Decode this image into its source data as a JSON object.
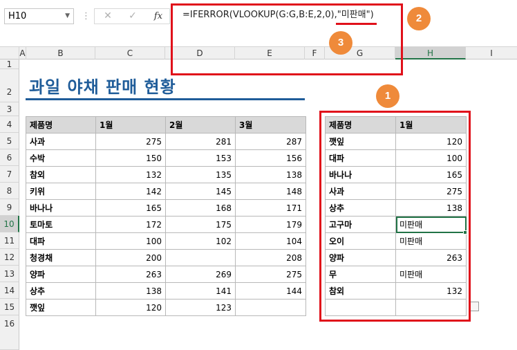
{
  "formula_bar": {
    "name_box": "H10",
    "cancel_symbol": "✕",
    "enter_symbol": "✓",
    "fx_label": "fx",
    "formula_text": "=IFERROR(VLOOKUP(G:G,B:E,2,0),\"미판매\")"
  },
  "columns": [
    "A",
    "B",
    "C",
    "D",
    "E",
    "F",
    "G",
    "H",
    "I"
  ],
  "rows": [
    "1",
    "2",
    "3",
    "4",
    "5",
    "6",
    "7",
    "8",
    "9",
    "10",
    "11",
    "12",
    "13",
    "14",
    "15",
    "16"
  ],
  "title": "과일 야채 판매 현황",
  "left_table": {
    "headers": [
      "제품명",
      "1월",
      "2월",
      "3월"
    ],
    "rows": [
      [
        "사과",
        "275",
        "281",
        "287"
      ],
      [
        "수박",
        "150",
        "153",
        "156"
      ],
      [
        "참외",
        "132",
        "135",
        "138"
      ],
      [
        "키위",
        "142",
        "145",
        "148"
      ],
      [
        "바나나",
        "165",
        "168",
        "171"
      ],
      [
        "토마토",
        "172",
        "175",
        "179"
      ],
      [
        "대파",
        "100",
        "102",
        "104"
      ],
      [
        "청경채",
        "200",
        "",
        "208"
      ],
      [
        "양파",
        "263",
        "269",
        "275"
      ],
      [
        "상추",
        "138",
        "141",
        "144"
      ],
      [
        "깻잎",
        "120",
        "123",
        ""
      ]
    ]
  },
  "right_table": {
    "headers": [
      "제품명",
      "1월"
    ],
    "rows": [
      [
        "깻잎",
        "120"
      ],
      [
        "대파",
        "100"
      ],
      [
        "바나나",
        "165"
      ],
      [
        "사과",
        "275"
      ],
      [
        "상추",
        "138"
      ],
      [
        "고구마",
        "미판매"
      ],
      [
        "오이",
        "미판매"
      ],
      [
        "양파",
        "263"
      ],
      [
        "무",
        "미판매"
      ],
      [
        "참외",
        "132"
      ],
      [
        "",
        ""
      ]
    ]
  },
  "badges": [
    "1",
    "2",
    "3"
  ],
  "colors": {
    "title_blue": "#1f5c99",
    "annotation_red": "#e0101a",
    "badge_orange": "#ef8a3a",
    "excel_green": "#217346"
  }
}
